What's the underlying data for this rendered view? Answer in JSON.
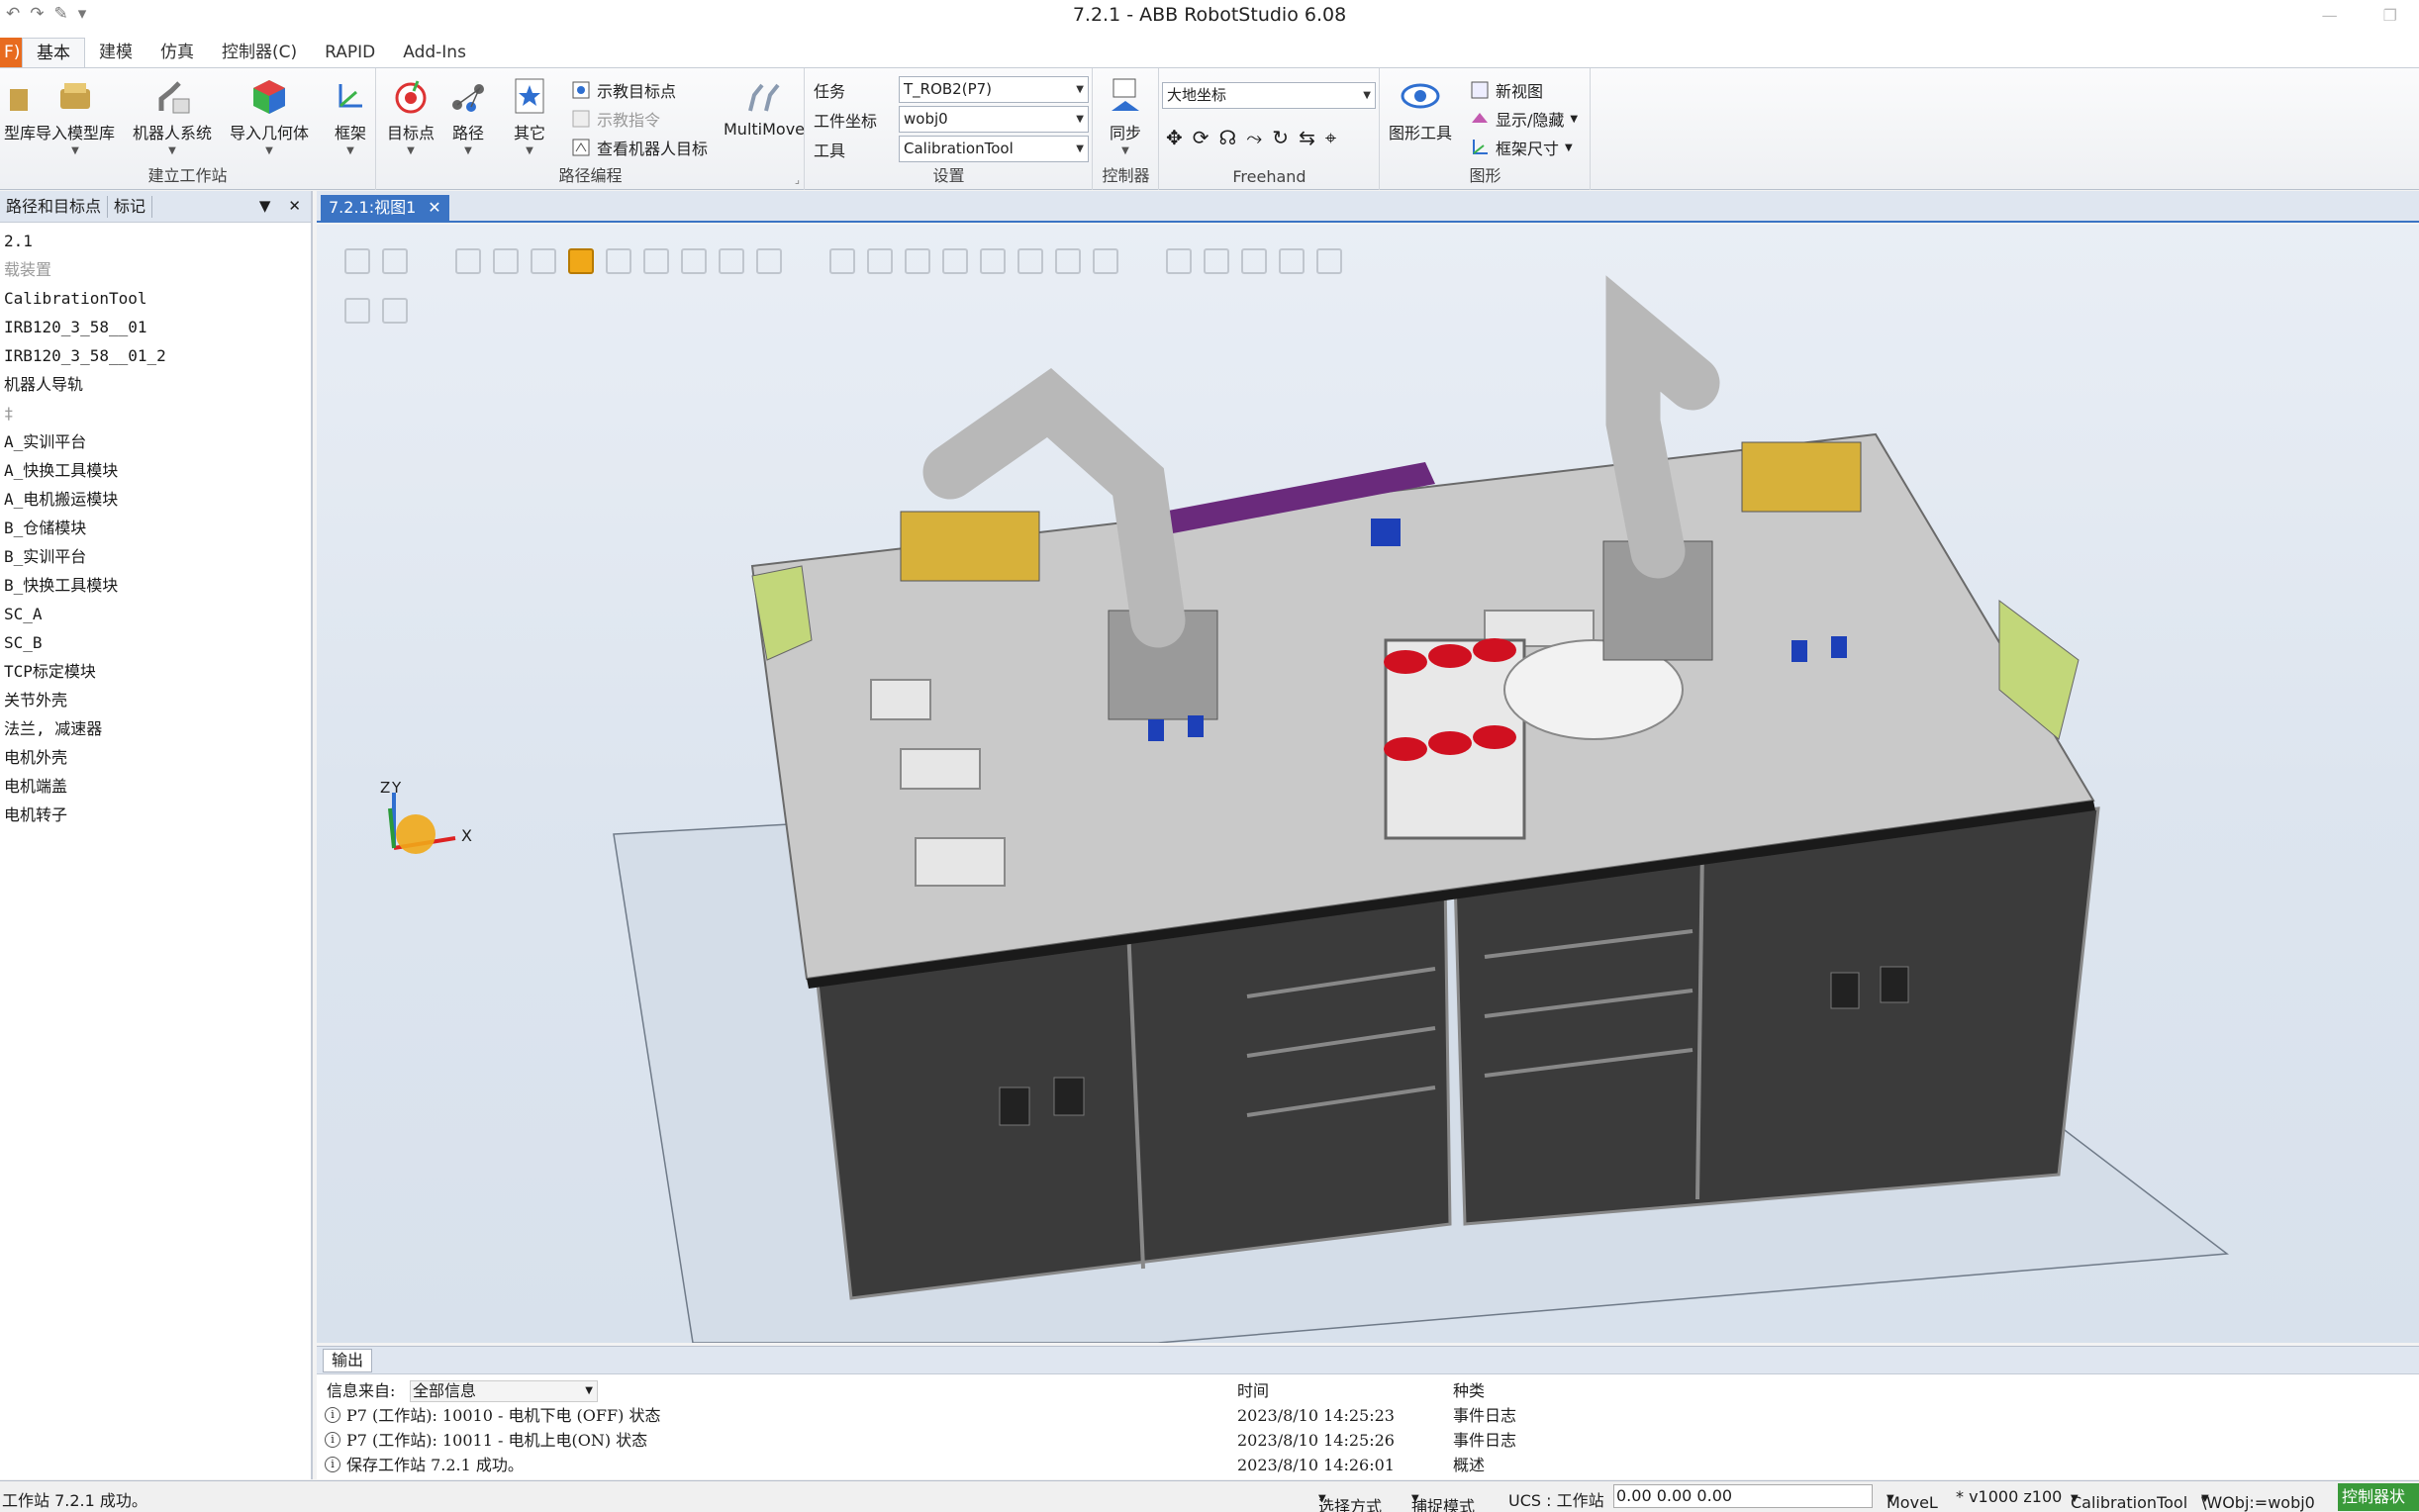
{
  "window": {
    "title": "7.2.1 - ABB RobotStudio 6.08"
  },
  "ribbon_tabs": [
    "F)",
    "基本",
    "建模",
    "仿真",
    "控制器(C)",
    "RAPID",
    "Add-Ins"
  ],
  "ribbon": {
    "build_station": {
      "label": "建立工作站",
      "buttons": [
        "型库",
        "导入模型库",
        "机器人系统",
        "导入几何体",
        "框架"
      ]
    },
    "path_programming": {
      "label": "路径编程",
      "buttons": [
        "目标点",
        "路径",
        "其它"
      ],
      "small": [
        "示教目标点",
        "示教指令",
        "查看机器人目标"
      ],
      "multimove": "MultiMove"
    },
    "settings": {
      "label": "设置",
      "task_label": "任务",
      "task_value": "T_ROB2(P7)",
      "wobj_label": "工件坐标",
      "wobj_value": "wobj0",
      "tool_label": "工具",
      "tool_value": "CalibrationTool"
    },
    "controller": {
      "label": "控制器",
      "sync": "同步"
    },
    "freehand": {
      "label": "Freehand",
      "coord": "大地坐标"
    },
    "graphics": {
      "label": "图形",
      "tool": "图形工具",
      "new_view": "新视图",
      "show_hide": "显示/隐藏",
      "frame_size": "框架尺寸"
    }
  },
  "left_panel": {
    "tabs": [
      "路径和目标点",
      "标记"
    ],
    "tree": [
      {
        "text": "2.1",
        "dim": false
      },
      {
        "text": "载装置",
        "dim": true
      },
      {
        "text": "CalibrationTool",
        "dim": false
      },
      {
        "text": "IRB120_3_58__01",
        "dim": false
      },
      {
        "text": "IRB120_3_58__01_2",
        "dim": false
      },
      {
        "text": "机器人导轨",
        "dim": false
      },
      {
        "text": "‡",
        "dim": true
      },
      {
        "text": "A_实训平台",
        "dim": false
      },
      {
        "text": "A_快换工具模块",
        "dim": false
      },
      {
        "text": "A_电机搬运模块",
        "dim": false
      },
      {
        "text": "B_仓储模块",
        "dim": false
      },
      {
        "text": "B_实训平台",
        "dim": false
      },
      {
        "text": "B_快换工具模块",
        "dim": false
      },
      {
        "text": "SC_A",
        "dim": false
      },
      {
        "text": "SC_B",
        "dim": false
      },
      {
        "text": "TCP标定模块",
        "dim": false
      },
      {
        "text": "关节外壳",
        "dim": false
      },
      {
        "text": "法兰, 减速器",
        "dim": false
      },
      {
        "text": "电机外壳",
        "dim": false
      },
      {
        "text": "电机端盖",
        "dim": false
      },
      {
        "text": "电机转子",
        "dim": false
      }
    ]
  },
  "document": {
    "tab": "7.2.1:视图1",
    "axes": {
      "x": "X",
      "y": "Y",
      "z": "Z"
    }
  },
  "output": {
    "tab": "输出",
    "filter_label": "信息来自:",
    "filter_value": "全部信息",
    "col_time": "时间",
    "col_category": "种类",
    "rows": [
      {
        "msg": "P7 (工作站): 10010 - 电机下电 (OFF) 状态",
        "time": "2023/8/10 14:25:23",
        "category": "事件日志"
      },
      {
        "msg": "P7 (工作站): 10011 - 电机上电(ON) 状态",
        "time": "2023/8/10 14:25:26",
        "category": "事件日志"
      },
      {
        "msg": "保存工作站 7.2.1 成功。",
        "time": "2023/8/10 14:26:01",
        "category": "概述"
      }
    ]
  },
  "status": {
    "message": "工作站 7.2.1 成功。",
    "select_mode": "选择方式",
    "snap_mode": "捕捉模式",
    "ucs": "UCS : 工作站",
    "coords": "0.00   0.00   0.00",
    "instruction": "MoveL",
    "speed": "* v1000  z100",
    "tool": "CalibrationTool",
    "wobj": "\\WObj:=wobj0",
    "controller_status": "控制器状"
  },
  "colors": {
    "accent": "#3b74c4",
    "file_tab": "#e86b1f",
    "controller_ok": "#3a9a3a"
  }
}
